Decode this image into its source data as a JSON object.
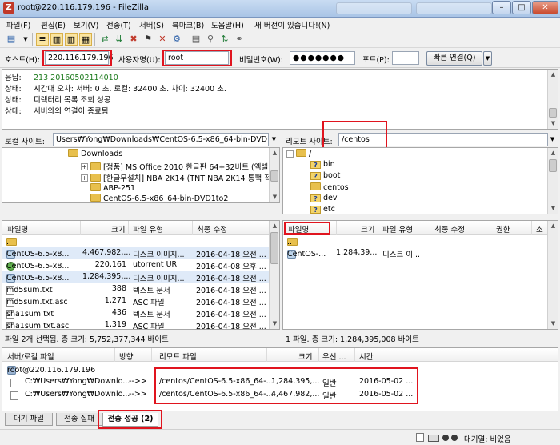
{
  "window": {
    "title": "root@220.116.179.196 - FileZilla"
  },
  "menu": [
    "파일(F)",
    "편집(E)",
    "보기(V)",
    "전송(T)",
    "서버(S)",
    "북마크(B)",
    "도움말(H)",
    "새 버전이 있습니다!(N)"
  ],
  "quickconnect": {
    "host_label": "호스트(H):",
    "host_value": "220.116.179.196",
    "user_label": "사용자명(U):",
    "user_value": "root",
    "pass_label": "비밀번호(W):",
    "pass_value": "●●●●●●●",
    "port_label": "포트(P):",
    "port_value": "",
    "connect_label": "빠른 연결(Q)"
  },
  "log": [
    {
      "k": "응답:",
      "v": "213 20160502114010",
      "color": "#1c7a1c"
    },
    {
      "k": "상태:",
      "v": "시간대 오차: 서버: 0 초. 로컬: 32400 초. 차이: 32400 초.",
      "color": "#000000"
    },
    {
      "k": "상태:",
      "v": "디렉터리 목록 조회 성공",
      "color": "#000000"
    },
    {
      "k": "상태:",
      "v": "서버와의 연결이 종료됨",
      "color": "#000000"
    }
  ],
  "local": {
    "site_label": "로컬 사이트:",
    "path": "Users₩Yong₩Downloads₩CentOS-6.5-x86_64-bin-DVD1to2₩",
    "tree": [
      "Downloads",
      "[정품] MS Office 2010 한글판 64+32비트 (엑셀,",
      "[한글무설치] NBA 2K14 (TNT NBA 2K14 통팩 적",
      "ABP-251",
      "CentOS-6.5-x86_64-bin-DVD1to2"
    ],
    "columns": [
      "파일명",
      "크기",
      "파일 유형",
      "최종 수정"
    ],
    "files": [
      {
        "name": "..",
        "size": "",
        "type": "",
        "modified": ""
      },
      {
        "name": "CentOS-6.5-x8...",
        "size": "4,467,982,...",
        "type": "디스크 이미지...",
        "modified": "2016-04-18 오전 ..."
      },
      {
        "name": "CentOS-6.5-x8...",
        "size": "220,161",
        "type": "utorrent URI",
        "modified": "2016-04-08 오후 ..."
      },
      {
        "name": "CentOS-6.5-x8...",
        "size": "1,284,395,...",
        "type": "디스크 이미지...",
        "modified": "2016-04-18 오전 ..."
      },
      {
        "name": "md5sum.txt",
        "size": "388",
        "type": "텍스트 문서",
        "modified": "2016-04-18 오전 ..."
      },
      {
        "name": "md5sum.txt.asc",
        "size": "1,271",
        "type": "ASC 파일",
        "modified": "2016-04-18 오전 ..."
      },
      {
        "name": "sha1sum.txt",
        "size": "436",
        "type": "텍스트 문서",
        "modified": "2016-04-18 오전 ..."
      },
      {
        "name": "sha1sum.txt.asc",
        "size": "1,319",
        "type": "ASC 파일",
        "modified": "2016-04-18 오전 ..."
      }
    ],
    "status": "파일 2개 선택됨. 총 크기: 5,752,377,344 바이트"
  },
  "remote": {
    "site_label": "리모트 사이트:",
    "path": "/centos",
    "tree": [
      "/",
      "bin",
      "boot",
      "centos",
      "dev",
      "etc"
    ],
    "columns": [
      "파일명",
      "크기",
      "파일 유형",
      "최종 수정",
      "권한",
      "소"
    ],
    "files": [
      {
        "name": "..",
        "size": "",
        "type": "",
        "modified": ""
      },
      {
        "name": "CentOS-...",
        "size": "1,284,39...",
        "type": "디스크 이...",
        "modified": ""
      }
    ],
    "status": "1 파일. 총 크기: 1,284,395,008 바이트"
  },
  "queue": {
    "columns": [
      "서버/로컬 파일",
      "방향",
      "리모트 파일",
      "크기",
      "우선 ...",
      "시간"
    ],
    "server": "root@220.116.179.196",
    "items": [
      {
        "local": "C:₩Users₩Yong₩Downlo...",
        "dir": "-->>",
        "remote": "/centos/CentOS-6.5-x86_64-...",
        "size": "1,284,395,...",
        "priority": "일반",
        "time": "2016-05-02 ..."
      },
      {
        "local": "C:₩Users₩Yong₩Downlo...",
        "dir": "-->>",
        "remote": "/centos/CentOS-6.5-x86_64-...",
        "size": "4,467,982,...",
        "priority": "일반",
        "time": "2016-05-02 ..."
      }
    ]
  },
  "tabs": [
    "대기 파일",
    "전송 실패",
    "전송 성공 (2)"
  ],
  "statusbar": {
    "queue": "대기열: 비었음"
  }
}
